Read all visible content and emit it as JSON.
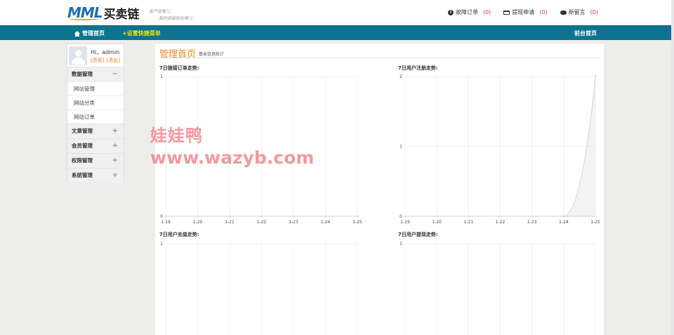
{
  "header": {
    "logo_mark": "MML",
    "logo_text": "买卖链",
    "slogan_line1": "客户在哪儿,",
    "slogan_line2": "我的链接就在哪儿!",
    "links": [
      {
        "label": "故障订单",
        "count": "(0)",
        "icon": "warning-icon"
      },
      {
        "label": "提现申请",
        "count": "(0)",
        "icon": "card-icon"
      },
      {
        "label": "新留言",
        "count": "(0)",
        "icon": "chat-icon"
      }
    ]
  },
  "nav": {
    "home": "管理首页",
    "quick": "+设置快捷菜单",
    "front": "前台首页"
  },
  "sidebar": {
    "greeting": "Hi，admin",
    "edit": "[改密]",
    "logout": "[退出]",
    "groups": [
      {
        "label": "数据管理",
        "sign": "−",
        "items": [
          "网站管理",
          "网站分类",
          "网站订单"
        ]
      },
      {
        "label": "文章管理",
        "sign": "+"
      },
      {
        "label": "会员管理",
        "sign": "+"
      },
      {
        "label": "权限管理",
        "sign": "+"
      },
      {
        "label": "系统管理",
        "sign": "+"
      }
    ]
  },
  "main": {
    "title": "管理首页",
    "subtitle": "基本信息统计"
  },
  "watermark": {
    "logo": "娃娃鸭",
    "url": "www.wazyb.com"
  },
  "chart_data": [
    {
      "type": "area",
      "title": "7日链接订单走势:",
      "categories": [
        "1-19",
        "1-20",
        "1-21",
        "1-22",
        "1-23",
        "1-24",
        "1-25"
      ],
      "values": [
        0,
        0,
        0,
        0,
        0,
        0,
        0
      ],
      "ylim": [
        0,
        1
      ],
      "yticks": [
        "0",
        "1"
      ],
      "grid": true
    },
    {
      "type": "area",
      "title": "7日用户注册走势:",
      "categories": [
        "1-19",
        "1-20",
        "1-21",
        "1-22",
        "1-23",
        "1-24",
        "1-25"
      ],
      "values": [
        0,
        0,
        0,
        0,
        0,
        0,
        2
      ],
      "ylim": [
        0,
        2
      ],
      "yticks": [
        "0",
        "1",
        "2"
      ],
      "grid": true
    },
    {
      "type": "area",
      "title": "7日用户充值走势:",
      "categories": [],
      "values": [],
      "ylim": [
        0,
        1
      ],
      "yticks": [
        "1"
      ],
      "grid": true
    },
    {
      "type": "area",
      "title": "7日用户提现走势:",
      "categories": [],
      "values": [],
      "ylim": [
        0,
        1
      ],
      "yticks": [
        "1"
      ],
      "grid": true
    }
  ]
}
